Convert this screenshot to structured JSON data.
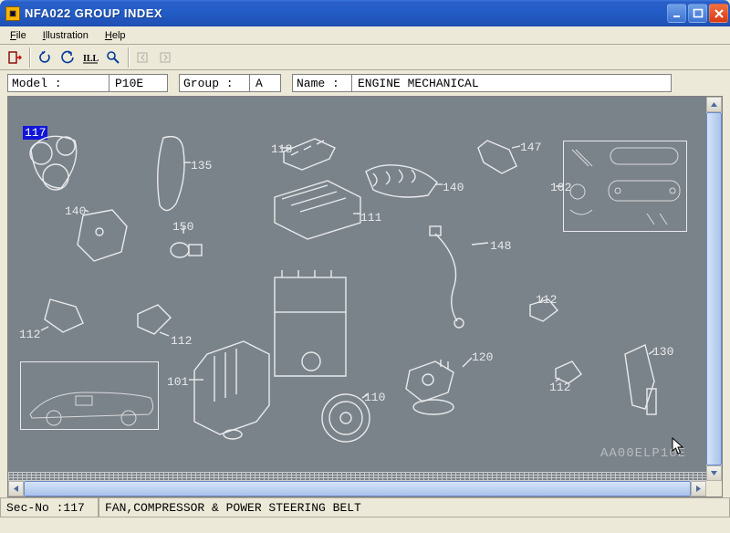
{
  "window": {
    "title": "NFA022 GROUP INDEX"
  },
  "menu": {
    "file": "File",
    "illustration": "Illustration",
    "help": "Help"
  },
  "fields": {
    "model_label": "Model :",
    "model_value": "P10E",
    "group_label": "Group :",
    "group_value": "A",
    "name_label": "Name :",
    "name_value": "ENGINE MECHANICAL"
  },
  "parts": {
    "p117": "117",
    "p135": "135",
    "p118": "118",
    "p147": "147",
    "p140_top": "140",
    "p102": "102",
    "p140_left": "140",
    "p150": "150",
    "p111": "111",
    "p148": "148",
    "p112_left": "112",
    "p112_mid": "112",
    "p112_r1": "112",
    "p112_r2": "112",
    "p101": "101",
    "p110": "110",
    "p120": "120",
    "p130": "130"
  },
  "watermark": "AA00ELP10E",
  "status": {
    "secno": "Sec-No :117",
    "desc": "FAN,COMPRESSOR & POWER STEERING BELT"
  }
}
